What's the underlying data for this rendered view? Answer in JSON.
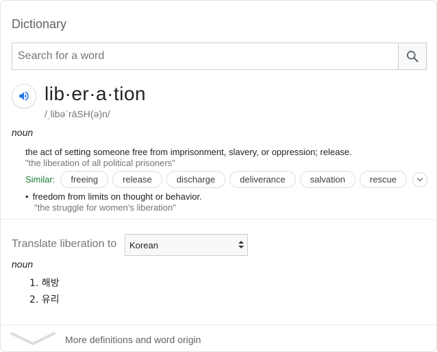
{
  "header": {
    "title": "Dictionary"
  },
  "search": {
    "placeholder": "Search for a word",
    "value": ""
  },
  "entry": {
    "word": "lib·er·a·tion",
    "phonetic": "/ˌlibəˈrāSH(ə)n/",
    "part_of_speech": "noun",
    "senses": [
      {
        "definition": "the act of setting someone free from imprisonment, slavery, or oppression; release.",
        "example": "\"the liberation of all political prisoners\""
      },
      {
        "definition": "freedom from limits on thought or behavior.",
        "example": "\"the struggle for women's liberation\""
      }
    ],
    "similar_label": "Similar:",
    "similar": [
      "freeing",
      "release",
      "discharge",
      "deliverance",
      "salvation",
      "rescue"
    ]
  },
  "translate": {
    "label": "Translate liberation to",
    "selected_language": "Korean",
    "part_of_speech": "noun",
    "items": [
      "1. 해방",
      "2. 유리"
    ]
  },
  "footer": {
    "more_label": "More definitions and word origin"
  },
  "colors": {
    "similar_label": "#188038",
    "speaker_icon": "#1a73e8",
    "example": "#70757a"
  },
  "icons": [
    "search-icon",
    "speaker-icon",
    "chevron-down-icon",
    "select-arrows-icon"
  ]
}
